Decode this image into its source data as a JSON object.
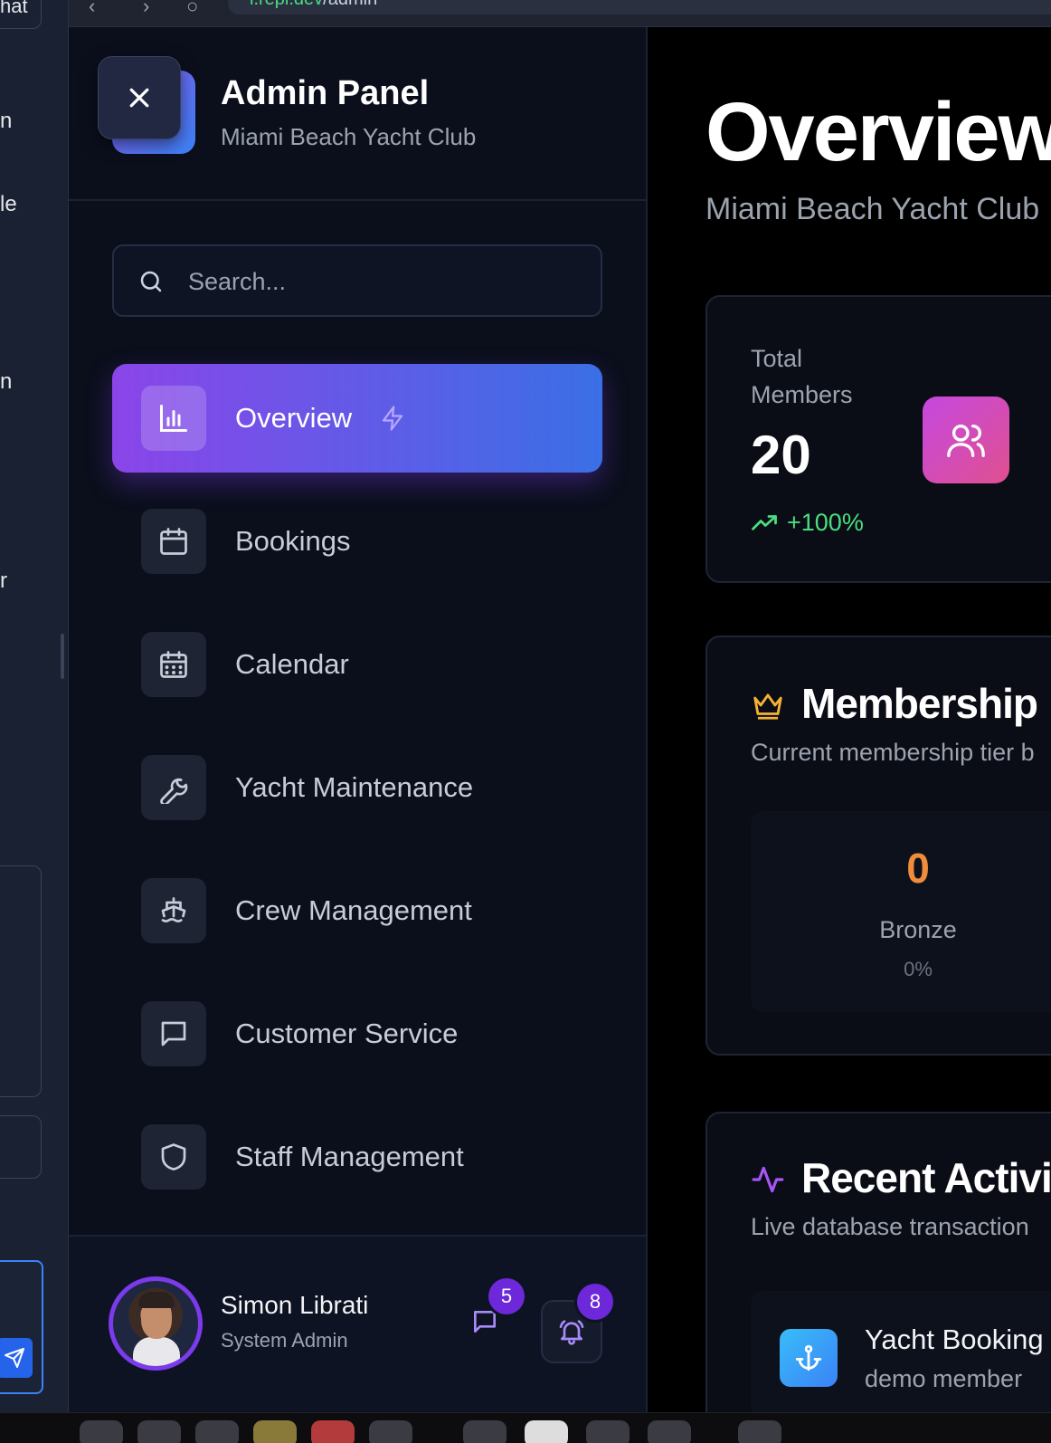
{
  "browser": {
    "url_host": "l.repl.dev",
    "url_path": "/admin"
  },
  "background_window": {
    "fragments": [
      "hat",
      "n",
      "le",
      "n",
      "r"
    ]
  },
  "sidebar": {
    "title": "Admin Panel",
    "subtitle": "Miami Beach Yacht Club",
    "search_placeholder": "Search...",
    "nav": [
      {
        "label": "Overview",
        "icon": "bar-chart-icon",
        "active": true,
        "extra_icon": "lightning-icon"
      },
      {
        "label": "Bookings",
        "icon": "calendar-icon"
      },
      {
        "label": "Calendar",
        "icon": "calendar-grid-icon"
      },
      {
        "label": "Yacht Maintenance",
        "icon": "wrench-icon"
      },
      {
        "label": "Crew Management",
        "icon": "ship-icon"
      },
      {
        "label": "Customer Service",
        "icon": "message-icon"
      },
      {
        "label": "Staff Management",
        "icon": "shield-icon"
      }
    ],
    "user": {
      "name": "Simon Librati",
      "role": "System Admin",
      "messages_count": "5",
      "notifications_count": "8"
    }
  },
  "main": {
    "title": "Overview",
    "subtitle": "Miami Beach Yacht Club",
    "stat": {
      "label": "Total Members",
      "value": "20",
      "trend": "+100%"
    },
    "membership": {
      "title": "Membership",
      "description": "Current membership tier b",
      "tier": {
        "count": "0",
        "name": "Bronze",
        "percent": "0%"
      }
    },
    "activity": {
      "title": "Recent Activit",
      "description": "Live database transaction",
      "item": {
        "title": "Yacht Booking",
        "subtitle": "demo  member"
      }
    }
  },
  "colors": {
    "accent_start": "#8b45e8",
    "accent_end": "#3a6fe6",
    "trend_green": "#4ade80",
    "bronze": "#f08c3a",
    "badge": "#6d28d9"
  }
}
